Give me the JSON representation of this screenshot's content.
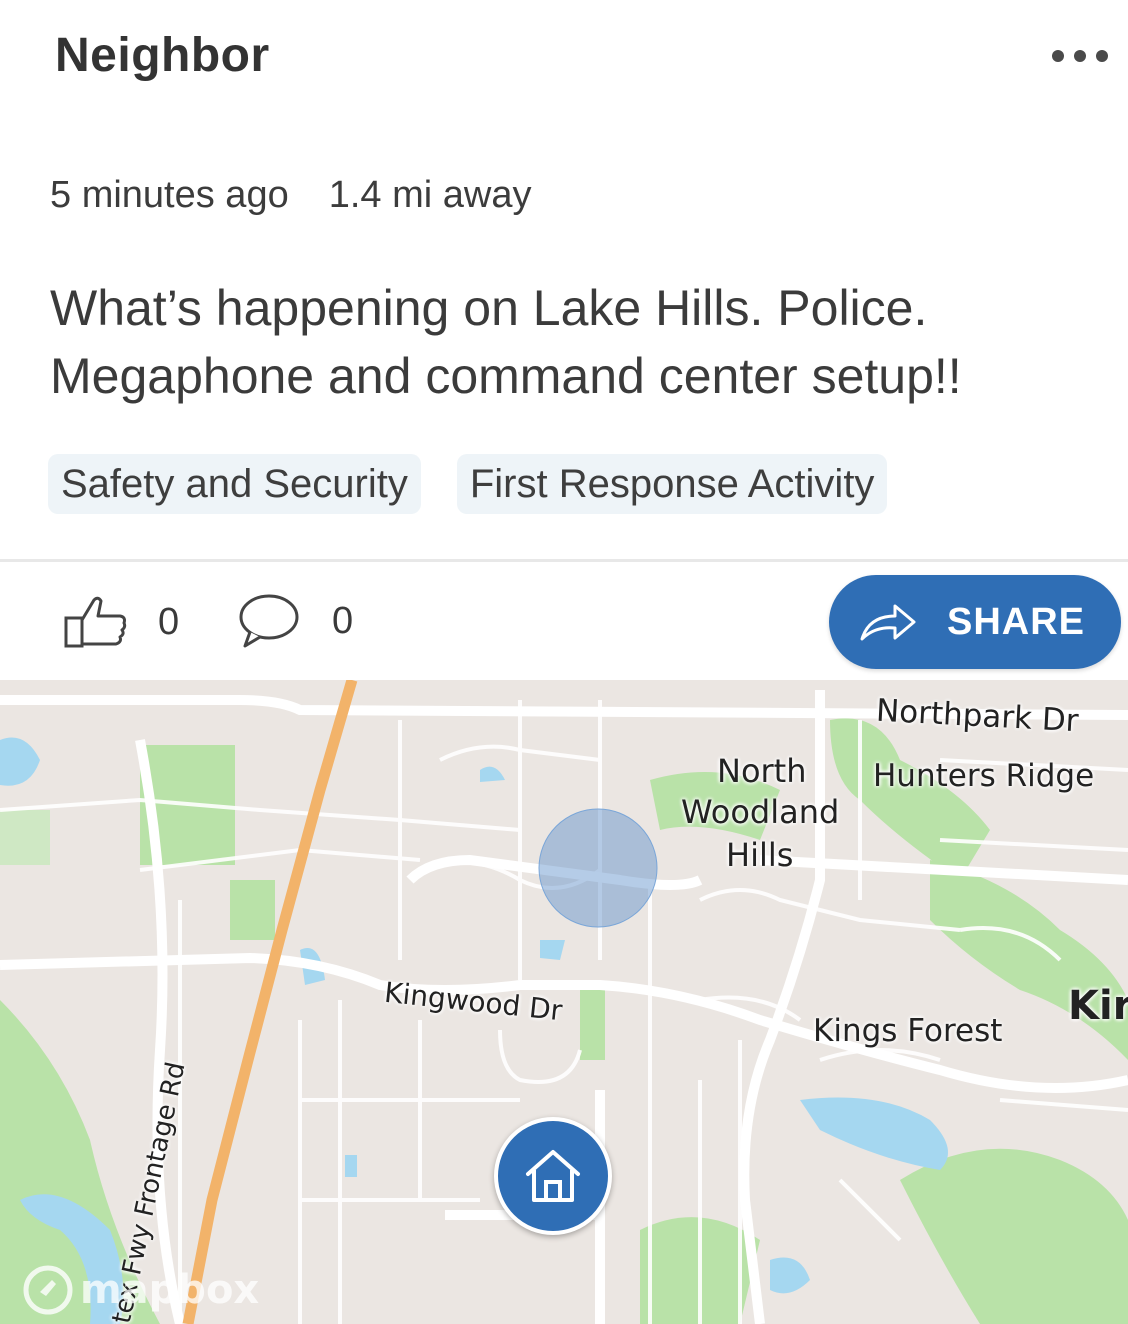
{
  "header": {
    "title": "Neighbor",
    "more_icon": "more-horizontal-icon"
  },
  "post": {
    "time_ago": "5 minutes ago",
    "distance": "1.4 mi away",
    "text": "What’s happening on Lake Hills. Police. Megaphone and command center setup!!",
    "tags": [
      "Safety and Security",
      "First Response Activity"
    ]
  },
  "actions": {
    "like_count": "0",
    "comment_count": "0",
    "share_label": "SHARE"
  },
  "map": {
    "labels": {
      "northpark": "Northpark Dr",
      "north_woodland_1": "North",
      "north_woodland_2": "Woodland",
      "north_woodland_3": "Hills",
      "hunters_ridge": "Hunters Ridge",
      "kingwood_dr": "Kingwood Dr",
      "kings_forest": "Kings Forest",
      "kin": "Kir",
      "frontage_rd": "stex Fwy Frontage Rd"
    },
    "attribution": "mapbox"
  },
  "colors": {
    "accent": "#2f6eb5",
    "tag_bg": "#eef4f8",
    "map_bg": "#ebe6e2",
    "park": "#b9e2a8",
    "water": "#a5d7f0",
    "highway": "#f2b36a"
  }
}
